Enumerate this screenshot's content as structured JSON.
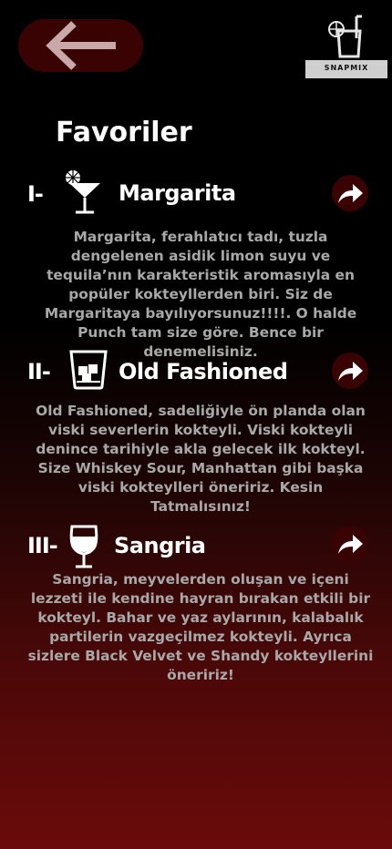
{
  "header": {
    "back_icon": "arrow-left-icon",
    "logo_text": "SNAPMIX"
  },
  "page": {
    "title": "Favoriler"
  },
  "favorites": [
    {
      "numeral": "I-",
      "icon": "cocktail-glass-icon",
      "name": "Margarita",
      "description": "Margarita, ferahlatıcı tadı, tuzla dengelenen asidik limon suyu ve tequila’nın karakteristik aromasıyla en popüler kokteyllerden biri. Siz de Margaritaya bayılıyorsunuz!!!!. O halde Punch tam size göre. Bence bir denemelisiniz."
    },
    {
      "numeral": "II-",
      "icon": "rocks-glass-icon",
      "name": "Old Fashioned",
      "description": "Old Fashioned, sadeliğiyle ön planda olan viski severlerin kokteyli.  Viski kokteyli denince tarihiyle akla gelecek ilk kokteyl. Size Whiskey Sour, Manhattan gibi başka viski kokteylleri öneririz. Kesin Tatmalısınız!"
    },
    {
      "numeral": "III-",
      "icon": "wine-glass-icon",
      "name": "Sangria",
      "description": "Sangria, meyvelerden oluşan ve içeni lezzeti ile kendine hayran bırakan etkili bir kokteyl.  Bahar ve yaz aylarının, kalabalık partilerin vazgeçilmez kokteyli.  Ayrıca sizlere Black Velvet ve Shandy kokteyllerini öneririz!"
    }
  ],
  "colors": {
    "button_bg": "#3a0303",
    "description_text": "#a8a8a8",
    "gradient_bottom": "#6b0a0a"
  }
}
